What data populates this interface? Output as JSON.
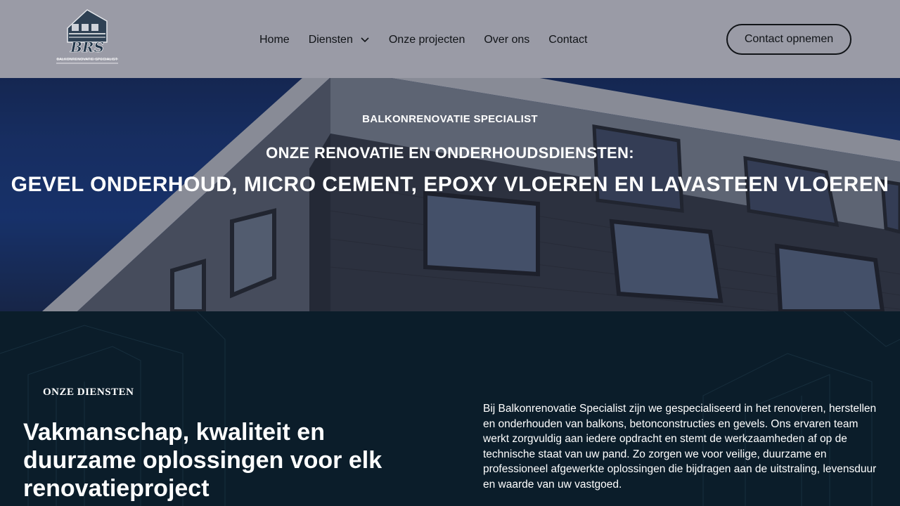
{
  "header": {
    "logo_mark": "BRS",
    "logo_tagline": "BALKONRENOVATIE SPECIALIST",
    "nav": [
      {
        "label": "Home"
      },
      {
        "label": "Diensten"
      },
      {
        "label": "Onze projecten"
      },
      {
        "label": "Over ons"
      },
      {
        "label": "Contact"
      }
    ],
    "cta_label": "Contact opnemen"
  },
  "hero": {
    "eyebrow": "BALKONRENOVATIE SPECIALIST",
    "subtitle": "ONZE RENOVATIE EN ONDERHOUDSDIENSTEN:",
    "title": "GEVEL ONDERHOUD, MICRO CEMENT, EPOXY VLOEREN EN LAVASTEEN VLOEREN"
  },
  "services": {
    "label": "ONZE DIENSTEN",
    "heading": "Vakmanschap, kwaliteit en duurzame oplossingen voor elk renovatieproject",
    "body": "Bij Balkonrenovatie Specialist zijn we gespecialiseerd in het renoveren, herstellen en onderhouden van balkons, betonconstructies en gevels. Ons ervaren team werkt zorgvuldig aan iedere opdracht en stemt de werkzaamheden af op de technische staat van uw pand. Zo zorgen we voor veilige, duurzame en professioneel afgewerkte oplossingen die bijdragen aan de uitstraling, levensduur en waarde van uw vastgoed."
  },
  "colors": {
    "header_bg": "#9a9ba6",
    "sky": "#1c3a7a",
    "section_bg": "#0b1d2a",
    "text_dark": "#111418",
    "text_light": "#ffffff"
  }
}
